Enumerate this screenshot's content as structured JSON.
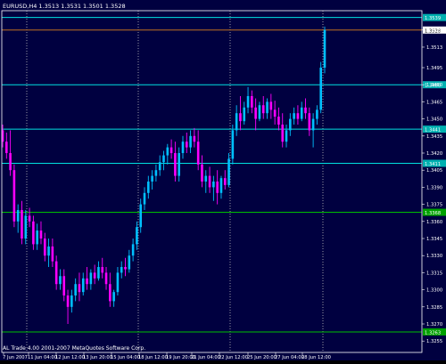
{
  "colors": {
    "background": "#000000",
    "plot_background": "#000040",
    "frame": "#ffffff",
    "grid": "#c0c0c0",
    "bull_candle": "#00c0ff",
    "bear_candle": "#ff00ff",
    "level_cyan": "#00e0e0",
    "level_green": "#00c000",
    "bid_line": "#c07020",
    "text": "#ffffff",
    "price_tag_bg": "#00b0b0",
    "green_tag_bg": "#00a000",
    "bid_tag_bg": "#ffffff"
  },
  "chart_data": {
    "type": "candlestick",
    "header": "EURUSD,H4  1.3513 1.3531 1.3501 1.3528",
    "copyright": "AL Trade 4.00 2001-2007 MetaQuotes Software Corp.",
    "y_ticks": [
      "1.3528",
      "1.3513",
      "1.3495",
      "1.3480",
      "1.3465",
      "1.3450",
      "1.3435",
      "1.3420",
      "1.3405",
      "1.3390",
      "1.3375",
      "1.3360",
      "1.3345",
      "1.3330",
      "1.3315",
      "1.3300",
      "1.3285",
      "1.3270",
      "1.3255"
    ],
    "x_ticks": [
      "7 Jun 2007",
      "11 Jun 04:00",
      "12 Jun 12:00",
      "13 Jun 20:00",
      "15 Jun 04:00",
      "18 Jun 12:00",
      "19 Jun 20:00",
      "21 Jun 04:00",
      "22 Jun 12:00",
      "25 Jun 20:00",
      "27 Jun 04:00",
      "28 Jun 12:00"
    ],
    "ylim": [
      1.3245,
      1.3545
    ],
    "current_price": "1.3528",
    "levels": [
      {
        "price": 1.348,
        "label": "1.3480",
        "style": "cyan"
      },
      {
        "price": 1.3441,
        "label": "1.3441",
        "style": "cyan"
      },
      {
        "price": 1.3411,
        "label": "1.3411",
        "style": "cyan"
      },
      {
        "price": 1.3368,
        "label": "1.3368",
        "style": "green"
      },
      {
        "price": 1.3263,
        "label": "1.3263",
        "style": "green"
      },
      {
        "price": 1.3539,
        "label": "1.3539",
        "style": "cyan"
      }
    ],
    "candles": [
      [
        1.344,
        1.3445,
        1.3425,
        1.343
      ],
      [
        1.343,
        1.3438,
        1.3415,
        1.342
      ],
      [
        1.342,
        1.344,
        1.34,
        1.3405
      ],
      [
        1.3405,
        1.341,
        1.3355,
        1.336
      ],
      [
        1.336,
        1.3375,
        1.335,
        1.337
      ],
      [
        1.337,
        1.3378,
        1.334,
        1.3345
      ],
      [
        1.3345,
        1.337,
        1.334,
        1.3365
      ],
      [
        1.3365,
        1.3372,
        1.3355,
        1.336
      ],
      [
        1.336,
        1.3365,
        1.3335,
        1.334
      ],
      [
        1.334,
        1.3358,
        1.3335,
        1.3352
      ],
      [
        1.3352,
        1.336,
        1.334,
        1.3345
      ],
      [
        1.3345,
        1.335,
        1.3325,
        1.333
      ],
      [
        1.333,
        1.3345,
        1.332,
        1.3338
      ],
      [
        1.3338,
        1.3345,
        1.332,
        1.3325
      ],
      [
        1.3325,
        1.333,
        1.33,
        1.3305
      ],
      [
        1.3305,
        1.3318,
        1.33,
        1.3312
      ],
      [
        1.3312,
        1.3318,
        1.329,
        1.3295
      ],
      [
        1.3295,
        1.33,
        1.327,
        1.3285
      ],
      [
        1.3285,
        1.33,
        1.328,
        1.3295
      ],
      [
        1.3295,
        1.331,
        1.329,
        1.3305
      ],
      [
        1.3305,
        1.3315,
        1.329,
        1.3298
      ],
      [
        1.3298,
        1.3315,
        1.3295,
        1.331
      ],
      [
        1.331,
        1.332,
        1.33,
        1.3305
      ],
      [
        1.3305,
        1.3318,
        1.33,
        1.3315
      ],
      [
        1.3315,
        1.3322,
        1.3305,
        1.331
      ],
      [
        1.331,
        1.3325,
        1.3308,
        1.332
      ],
      [
        1.332,
        1.3328,
        1.331,
        1.3315
      ],
      [
        1.3315,
        1.332,
        1.33,
        1.3305
      ],
      [
        1.3305,
        1.3315,
        1.3285,
        1.329
      ],
      [
        1.329,
        1.33,
        1.3285,
        1.3298
      ],
      [
        1.3298,
        1.332,
        1.3295,
        1.3315
      ],
      [
        1.3315,
        1.3325,
        1.331,
        1.332
      ],
      [
        1.332,
        1.3328,
        1.3312,
        1.3318
      ],
      [
        1.3318,
        1.3335,
        1.3315,
        1.333
      ],
      [
        1.333,
        1.3345,
        1.3325,
        1.334
      ],
      [
        1.334,
        1.336,
        1.3335,
        1.3355
      ],
      [
        1.3355,
        1.338,
        1.335,
        1.3375
      ],
      [
        1.3375,
        1.339,
        1.337,
        1.3385
      ],
      [
        1.3385,
        1.34,
        1.338,
        1.3395
      ],
      [
        1.3395,
        1.3405,
        1.3388,
        1.34
      ],
      [
        1.34,
        1.341,
        1.3395,
        1.3405
      ],
      [
        1.3405,
        1.3418,
        1.34,
        1.3412
      ],
      [
        1.3412,
        1.3422,
        1.3405,
        1.3418
      ],
      [
        1.3418,
        1.3428,
        1.341,
        1.3425
      ],
      [
        1.3425,
        1.3432,
        1.3415,
        1.342
      ],
      [
        1.342,
        1.343,
        1.3395,
        1.34
      ],
      [
        1.34,
        1.3425,
        1.3395,
        1.342
      ],
      [
        1.342,
        1.3435,
        1.3415,
        1.343
      ],
      [
        1.343,
        1.3438,
        1.342,
        1.3425
      ],
      [
        1.3425,
        1.344,
        1.342,
        1.3435
      ],
      [
        1.3435,
        1.3442,
        1.3425,
        1.343
      ],
      [
        1.343,
        1.344,
        1.3405,
        1.341
      ],
      [
        1.341,
        1.3418,
        1.339,
        1.3395
      ],
      [
        1.3395,
        1.3405,
        1.3385,
        1.34
      ],
      [
        1.34,
        1.3408,
        1.3385,
        1.339
      ],
      [
        1.339,
        1.34,
        1.3378,
        1.3395
      ],
      [
        1.3395,
        1.3405,
        1.3375,
        1.3385
      ],
      [
        1.3385,
        1.34,
        1.338,
        1.3398
      ],
      [
        1.3398,
        1.3405,
        1.3388,
        1.3392
      ],
      [
        1.3392,
        1.342,
        1.339,
        1.3415
      ],
      [
        1.3415,
        1.3445,
        1.341,
        1.344
      ],
      [
        1.344,
        1.3462,
        1.3435,
        1.3455
      ],
      [
        1.3455,
        1.347,
        1.344,
        1.3448
      ],
      [
        1.3448,
        1.3465,
        1.3445,
        1.346
      ],
      [
        1.346,
        1.3478,
        1.3455,
        1.347
      ],
      [
        1.347,
        1.3475,
        1.3455,
        1.346
      ],
      [
        1.346,
        1.3468,
        1.344,
        1.345
      ],
      [
        1.345,
        1.3465,
        1.3448,
        1.3462
      ],
      [
        1.3462,
        1.347,
        1.345,
        1.3455
      ],
      [
        1.3455,
        1.3468,
        1.345,
        1.3465
      ],
      [
        1.3465,
        1.3472,
        1.345,
        1.3458
      ],
      [
        1.3458,
        1.3466,
        1.3445,
        1.3452
      ],
      [
        1.3452,
        1.346,
        1.344,
        1.3445
      ],
      [
        1.3445,
        1.3455,
        1.3425,
        1.343
      ],
      [
        1.343,
        1.3445,
        1.3425,
        1.344
      ],
      [
        1.344,
        1.3455,
        1.3435,
        1.345
      ],
      [
        1.345,
        1.346,
        1.3445,
        1.3455
      ],
      [
        1.3455,
        1.3462,
        1.3445,
        1.345
      ],
      [
        1.345,
        1.3465,
        1.3448,
        1.346
      ],
      [
        1.346,
        1.3468,
        1.345,
        1.3455
      ],
      [
        1.3455,
        1.346,
        1.3435,
        1.344
      ],
      [
        1.344,
        1.3455,
        1.3425,
        1.345
      ],
      [
        1.345,
        1.3462,
        1.3445,
        1.3458
      ],
      [
        1.3458,
        1.35,
        1.3455,
        1.3495
      ],
      [
        1.3495,
        1.3531,
        1.349,
        1.3528
      ]
    ]
  }
}
